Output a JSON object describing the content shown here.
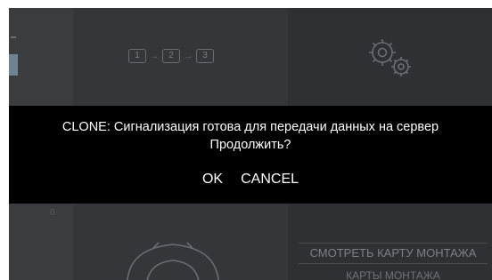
{
  "dialog": {
    "line1": "CLONE: Сигнализация готова для передачи данных на сервер",
    "line2": "Продолжить?",
    "ok_label": "OK",
    "cancel_label": "CANCEL"
  },
  "background": {
    "steps": [
      "1",
      "2",
      "3"
    ],
    "side_digit": "0",
    "menu": {
      "view_map_label": "СМОТРЕТЬ КАРТУ МОНТАЖА",
      "maps_label": "КАРТЫ МОНТАЖА"
    }
  },
  "icons": {
    "gears": "gears-icon",
    "car": "car-icon",
    "arrow": "arrow-right-icon"
  },
  "colors": {
    "overlay": "#000000",
    "app_background": "#2c2e31",
    "dialog_text": "#ffffff"
  }
}
